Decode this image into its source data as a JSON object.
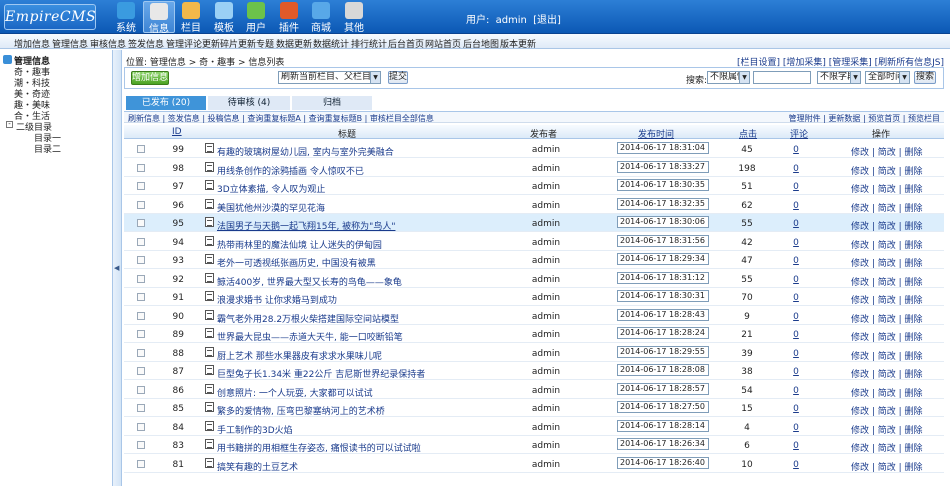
{
  "header": {
    "logo": "EmpireCMS",
    "nav": [
      {
        "label": "系统",
        "icon": "globe-icon",
        "color": "#3a9be0"
      },
      {
        "label": "信息",
        "icon": "document-icon",
        "color": "#e8e8e8"
      },
      {
        "label": "栏目",
        "icon": "folders-icon",
        "color": "#f2b84a"
      },
      {
        "label": "模板",
        "icon": "template-icon",
        "color": "#9ad0f5"
      },
      {
        "label": "用户",
        "icon": "user-icon",
        "color": "#6cc24a"
      },
      {
        "label": "插件",
        "icon": "tools-icon",
        "color": "#e05a2a"
      },
      {
        "label": "商城",
        "icon": "shop-icon",
        "color": "#58a8e8"
      },
      {
        "label": "其他",
        "icon": "gear-icon",
        "color": "#d8d8d8"
      }
    ],
    "user_label": "用户:",
    "username": "admin",
    "logout": "[退出]"
  },
  "menubar": [
    "增加信息",
    "管理信息",
    "审核信息",
    "签发信息",
    "管理评论",
    "更新碎片",
    "更新专题",
    "数据更新",
    "数据统计",
    "排行统计",
    "后台首页",
    "网站首页",
    "后台地图",
    "版本更新"
  ],
  "sidebar": {
    "root": "管理信息",
    "items": [
      "奇・趣事",
      "潮・科技",
      "美・奇迹",
      "趣・美味",
      "合・生活",
      "二级目录",
      "目录一",
      "目录二"
    ]
  },
  "main": {
    "breadcrumb": "位置: 管理信息 > 奇・趣事 > 信息列表",
    "top_links": "[栏目设置] [增加采集] [管理采集] [刷新所有信息JS]",
    "add_button": "增加信息",
    "refresh_select": "刷新当前栏目、父栏目与首页",
    "submit_button": "提交",
    "search_label": "搜索:",
    "attr_select": "不限属性",
    "search_input": "",
    "field_select": "不限字段",
    "time_select": "全部时间",
    "search_button": "搜索",
    "tabs": [
      "已发布 (20)",
      "待审核 (4)",
      "归档"
    ],
    "actions_left": "刷新信息 | 签发信息 | 投稿信息 | 查询重复标题A | 查询重复标题B | 审核栏目全部信息",
    "actions_right": "管理附件 | 更新数据 | 预览首页 | 预览栏目",
    "columns": {
      "id": "ID",
      "title": "标题",
      "publisher": "发布者",
      "time": "发布时间",
      "clicks": "点击",
      "comments": "评论",
      "ops": "操作"
    },
    "ops_text": "修改 | 简改 | 删除",
    "rows": [
      {
        "id": "99",
        "title": "有趣的玻璃树屋幼儿园, 室内与室外完美融合",
        "publisher": "admin",
        "time": "2014-06-17 18:31:04",
        "clicks": "45",
        "comments": "0"
      },
      {
        "id": "98",
        "title": "用线条创作的涂鸦插画 令人惊叹不已",
        "publisher": "admin",
        "time": "2014-06-17 18:33:27",
        "clicks": "198",
        "comments": "0"
      },
      {
        "id": "97",
        "title": "3D立体素描, 令人叹为观止",
        "publisher": "admin",
        "time": "2014-06-17 18:30:35",
        "clicks": "51",
        "comments": "0"
      },
      {
        "id": "96",
        "title": "美国犹他州沙漠的罕见花海",
        "publisher": "admin",
        "time": "2014-06-17 18:32:35",
        "clicks": "62",
        "comments": "0"
      },
      {
        "id": "95",
        "title": "法国男子与天鹅一起飞翔15年, 被称为\"鸟人\"",
        "publisher": "admin",
        "time": "2014-06-17 18:30:06",
        "clicks": "55",
        "comments": "0"
      },
      {
        "id": "94",
        "title": "热带雨林里的魔法仙境 让人迷失的伊甸园",
        "publisher": "admin",
        "time": "2014-06-17 18:31:56",
        "clicks": "42",
        "comments": "0"
      },
      {
        "id": "93",
        "title": "老外一可透视纸张画历史, 中国没有被黑",
        "publisher": "admin",
        "time": "2014-06-17 18:29:34",
        "clicks": "47",
        "comments": "0"
      },
      {
        "id": "92",
        "title": "鲸活400岁, 世界最大型又长寿的鸟龟——象龟",
        "publisher": "admin",
        "time": "2014-06-17 18:31:12",
        "clicks": "55",
        "comments": "0"
      },
      {
        "id": "91",
        "title": "浪漫求婚书 让你求婚马到成功",
        "publisher": "admin",
        "time": "2014-06-17 18:30:31",
        "clicks": "70",
        "comments": "0"
      },
      {
        "id": "90",
        "title": "霸气老外用28.2万根火柴搭建国际空间站模型",
        "publisher": "admin",
        "time": "2014-06-17 18:28:43",
        "clicks": "9",
        "comments": "0"
      },
      {
        "id": "89",
        "title": "世界最大昆虫——赤道大天牛, 能一口咬断铅笔",
        "publisher": "admin",
        "time": "2014-06-17 18:28:24",
        "clicks": "21",
        "comments": "0"
      },
      {
        "id": "88",
        "title": "厨上艺术 那些水果器皮有求求水果味儿呢",
        "publisher": "admin",
        "time": "2014-06-17 18:29:55",
        "clicks": "39",
        "comments": "0"
      },
      {
        "id": "87",
        "title": "巨型兔子长1.34米 重22公斤 吉尼斯世界纪录保持者",
        "publisher": "admin",
        "time": "2014-06-17 18:28:08",
        "clicks": "38",
        "comments": "0"
      },
      {
        "id": "86",
        "title": "创意照片: 一个人玩耍, 大家都可以试试",
        "publisher": "admin",
        "time": "2014-06-17 18:28:57",
        "clicks": "54",
        "comments": "0"
      },
      {
        "id": "85",
        "title": "繁多的爱情物, 压弯巴黎塞纳河上的艺术桥",
        "publisher": "admin",
        "time": "2014-06-17 18:27:50",
        "clicks": "15",
        "comments": "0"
      },
      {
        "id": "84",
        "title": "手工制作的3D火焰",
        "publisher": "admin",
        "time": "2014-06-17 18:28:14",
        "clicks": "4",
        "comments": "0"
      },
      {
        "id": "83",
        "title": "用书籍拼的用相框生存姿态, 痛恨读书的可以试试啦",
        "publisher": "admin",
        "time": "2014-06-17 18:26:34",
        "clicks": "6",
        "comments": "0"
      },
      {
        "id": "81",
        "title": "搞笑有趣的土豆艺术",
        "publisher": "admin",
        "time": "2014-06-17 18:26:40",
        "clicks": "10",
        "comments": "0"
      }
    ]
  }
}
